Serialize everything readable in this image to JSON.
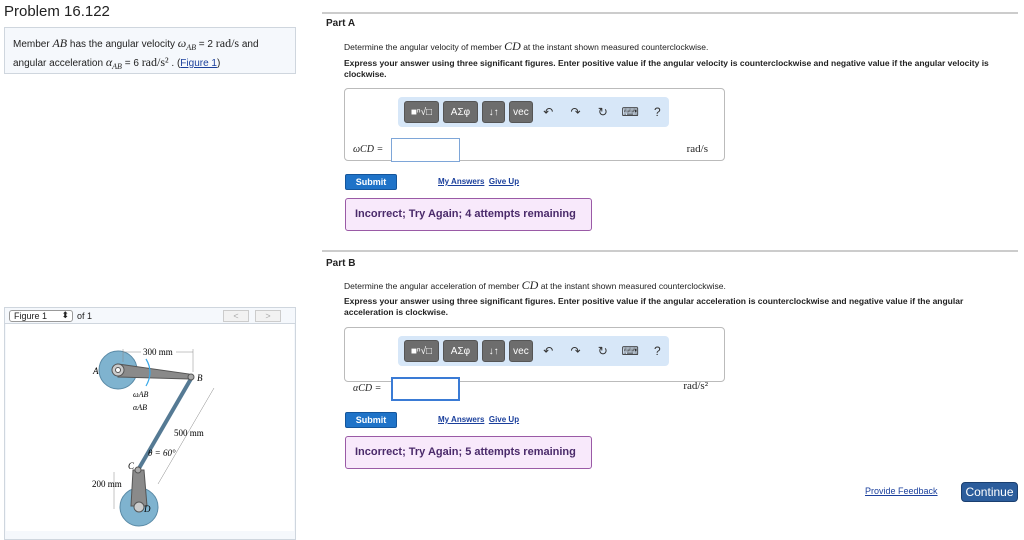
{
  "problem": {
    "title": "Problem 16.122",
    "statement": {
      "t1": "Member ",
      "ab": "AB",
      "t2": " has the angular velocity ",
      "omega": "ω",
      "omega_sub": "AB",
      "t3": " = 2 ",
      "unit1": "rad/s",
      "t4": " and",
      "t5": "angular acceleration ",
      "alpha": "α",
      "alpha_sub": "AB",
      "t6": " = 6 ",
      "unit2": "rad/s²",
      "t7": " . (",
      "fig_link": "Figure 1",
      "t8": ")"
    }
  },
  "figure": {
    "select": "Figure 1",
    "of": "of 1",
    "prev": "<",
    "next": ">",
    "labels": {
      "a": "A",
      "b": "B",
      "c": "C",
      "d": "D",
      "d300": "300 mm",
      "d500": "500 mm",
      "d200": "200 mm",
      "theta": "θ = 60°",
      "wab": "ωAB",
      "aab": "αAB"
    }
  },
  "toolbar": {
    "templates": "■ⁿ√□",
    "greek": "ΑΣφ",
    "arrows": "↓↑",
    "vec": "vec",
    "undo": "↶",
    "redo": "↷",
    "reset": "↻",
    "keyboard": "⌨",
    "help": "?"
  },
  "partA": {
    "label": "Part A",
    "q1": "Determine the angular velocity of member ",
    "qvar": "CD",
    "q2": " at the instant shown measured counterclockwise.",
    "instr": "Express your answer using three significant figures. Enter positive value if the angular velocity is counterclockwise and negative value if the angular velocity is clockwise.",
    "var": "ωCD =",
    "value": "",
    "unit": "rad/s",
    "submit": "Submit",
    "my_answers": "My Answers",
    "give_up": "Give Up",
    "feedback": "Incorrect; Try Again; 4 attempts remaining"
  },
  "partB": {
    "label": "Part B",
    "q1": "Determine the angular acceleration of member ",
    "qvar": "CD",
    "q2": " at the instant shown measured counterclockwise.",
    "instr": "Express your answer using three significant figures. Enter positive value if the angular acceleration is counterclockwise and negative value if the angular acceleration is clockwise.",
    "var": "αCD =",
    "value": "",
    "unit": "rad/s²",
    "submit": "Submit",
    "my_answers": "My Answers",
    "give_up": "Give Up",
    "feedback": "Incorrect; Try Again; 5 attempts remaining"
  },
  "footer": {
    "feedback": "Provide Feedback",
    "continue": "Continue"
  }
}
